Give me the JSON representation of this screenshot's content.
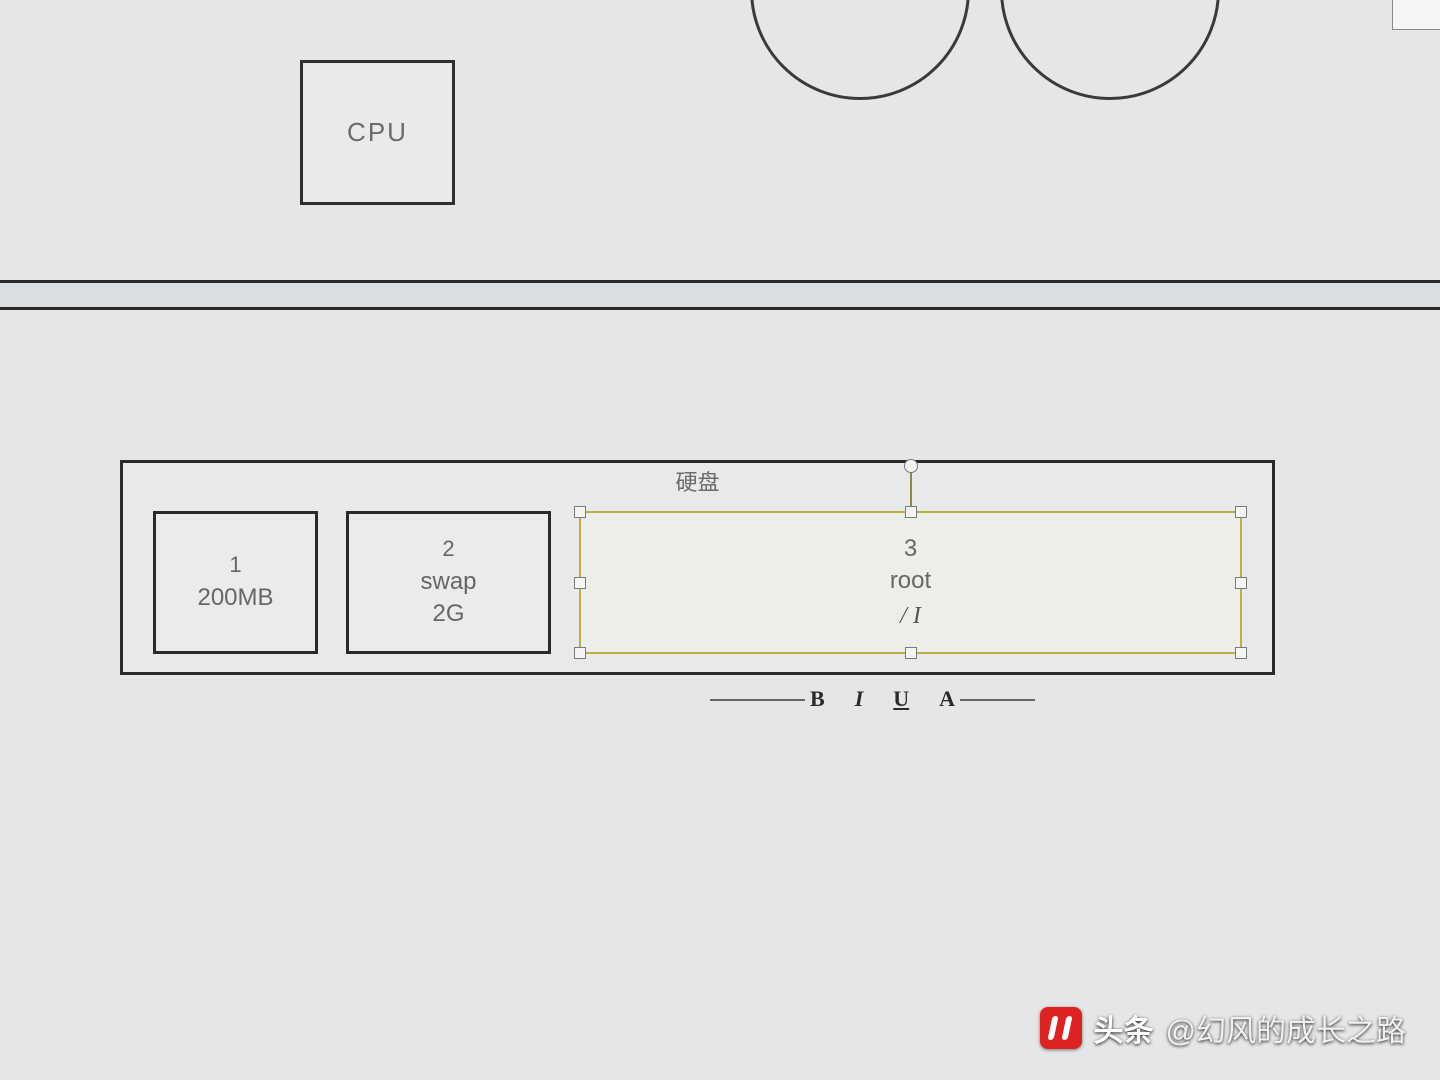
{
  "cpu": {
    "label": "CPU"
  },
  "disk": {
    "title": "硬盘",
    "partitions": [
      {
        "index": "1",
        "label": "200MB"
      },
      {
        "index": "2",
        "label": "swap",
        "size": "2G"
      },
      {
        "index": "3",
        "label": "root",
        "cursor": "/ I"
      }
    ]
  },
  "format_toolbar": {
    "bold": "B",
    "italic": "I",
    "underline": "U",
    "font_color": "A"
  },
  "watermark": {
    "brand": "头条",
    "author": "@幻风的成长之路"
  }
}
